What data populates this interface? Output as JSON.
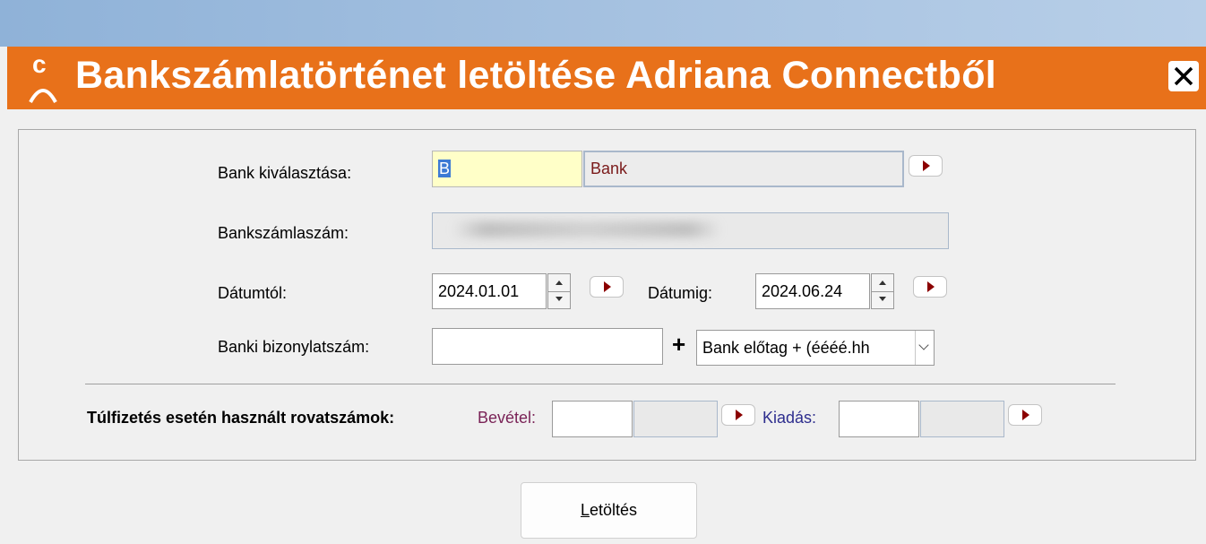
{
  "window": {
    "title": "Bankszámlatörténet letöltése Adriana Connectből",
    "logo_letter": "c",
    "accent_color": "#e8711a",
    "close_icon": "close-icon"
  },
  "form": {
    "bank_label": "Bank kiválasztása:",
    "bank_code_value": "B",
    "bank_name_value": "Bank",
    "account_label": "Bankszámlaszám:",
    "account_value": "",
    "date_from_label": "Dátumtól:",
    "date_from_value": "2024.01.01",
    "date_to_label": "Dátumig:",
    "date_to_value": "2024.06.24",
    "doc_number_label": "Banki bizonylatszám:",
    "doc_number_value": "",
    "plus_sign": "+",
    "prefix_select_value": "Bank előtag + (éééé.hh"
  },
  "overpay": {
    "label": "Túlfizetés esetén használt rovatszámok:",
    "income_label": "Bevétel:",
    "income_code": "",
    "income_name": "",
    "expense_label": "Kiadás:",
    "expense_code": "",
    "expense_name": ""
  },
  "actions": {
    "download_hotkey": "L",
    "download_rest": "etöltés"
  }
}
